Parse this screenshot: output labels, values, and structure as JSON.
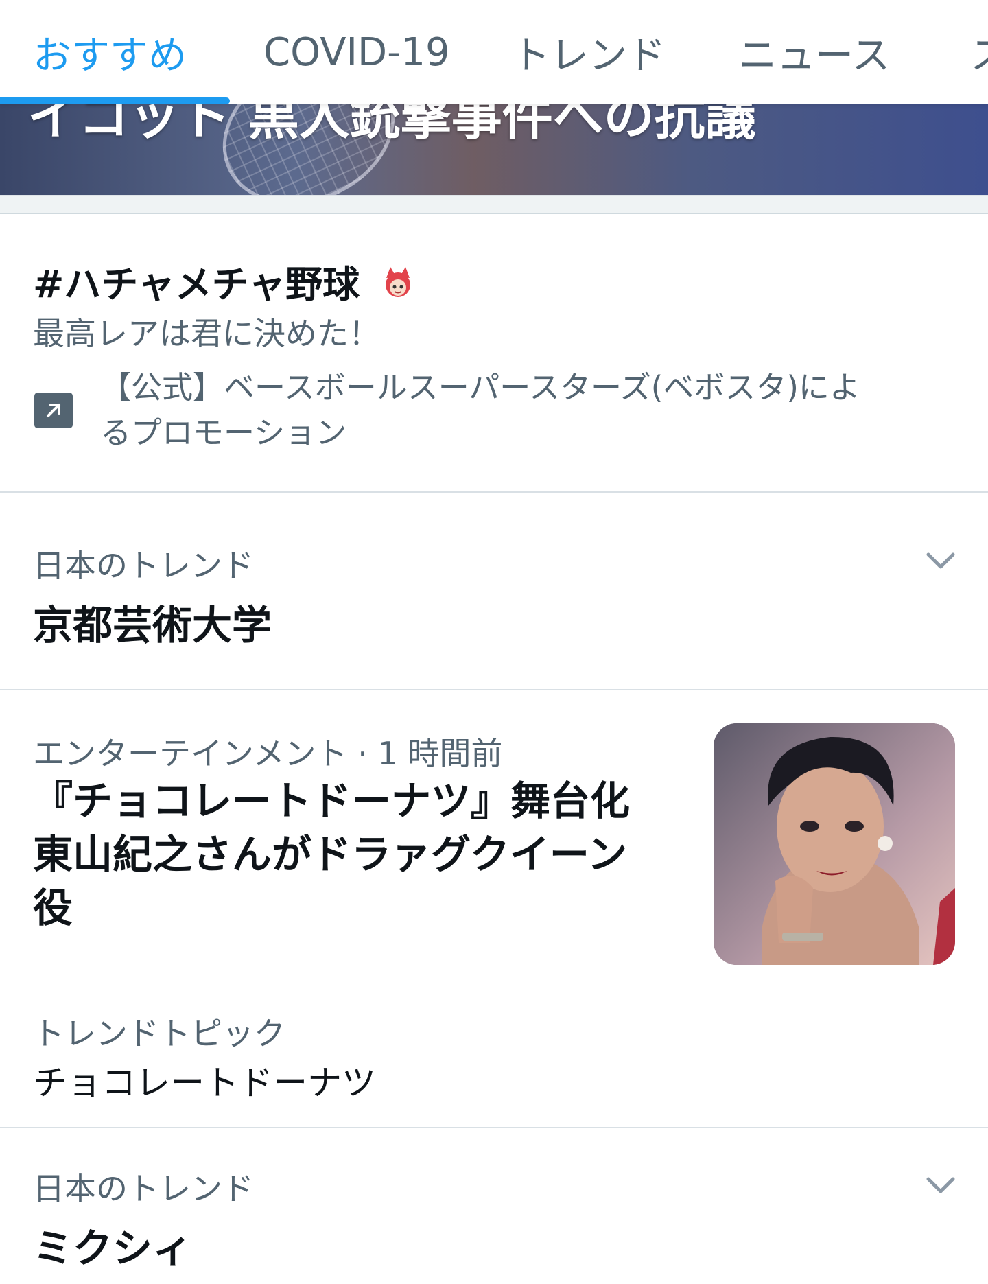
{
  "tabs": [
    {
      "label": "おすすめ",
      "active": true
    },
    {
      "label": "COVID-19",
      "active": false
    },
    {
      "label": "トレンド",
      "active": false
    },
    {
      "label": "ニュース",
      "active": false
    },
    {
      "label": "ス",
      "active": false
    }
  ],
  "hero": {
    "headline": "イコット 黒人銃撃事件への抗議"
  },
  "promo": {
    "hashtag": "#ハチャメチャ野球",
    "tagline": "最高レアは君に決めた！",
    "advertiser_line1": "【公式】ベースボールスーパースターズ(ベボスタ)によ",
    "advertiser_line2": "るプロモーション",
    "icon": "promoted-arrow-icon"
  },
  "trends": [
    {
      "context": "日本のトレンド",
      "title": "京都芸術大学",
      "icon": "chevron-down-icon"
    },
    {
      "context": "日本のトレンド",
      "title": "ミクシィ",
      "icon": "chevron-down-icon"
    }
  ],
  "news": {
    "meta": "エンターテインメント · 1 時間前",
    "title_line1": "『チョコレートドーナツ』舞台化",
    "title_line2": "東山紀之さんがドラァグクイーン",
    "title_line3": "役",
    "topic_label": "トレンドトピック",
    "topic_name": "チョコレートドーナツ"
  },
  "colors": {
    "accent": "#1d9bf0",
    "muted_text": "#536471",
    "primary_text": "#0f1419",
    "divider": "#d9e0e5"
  }
}
